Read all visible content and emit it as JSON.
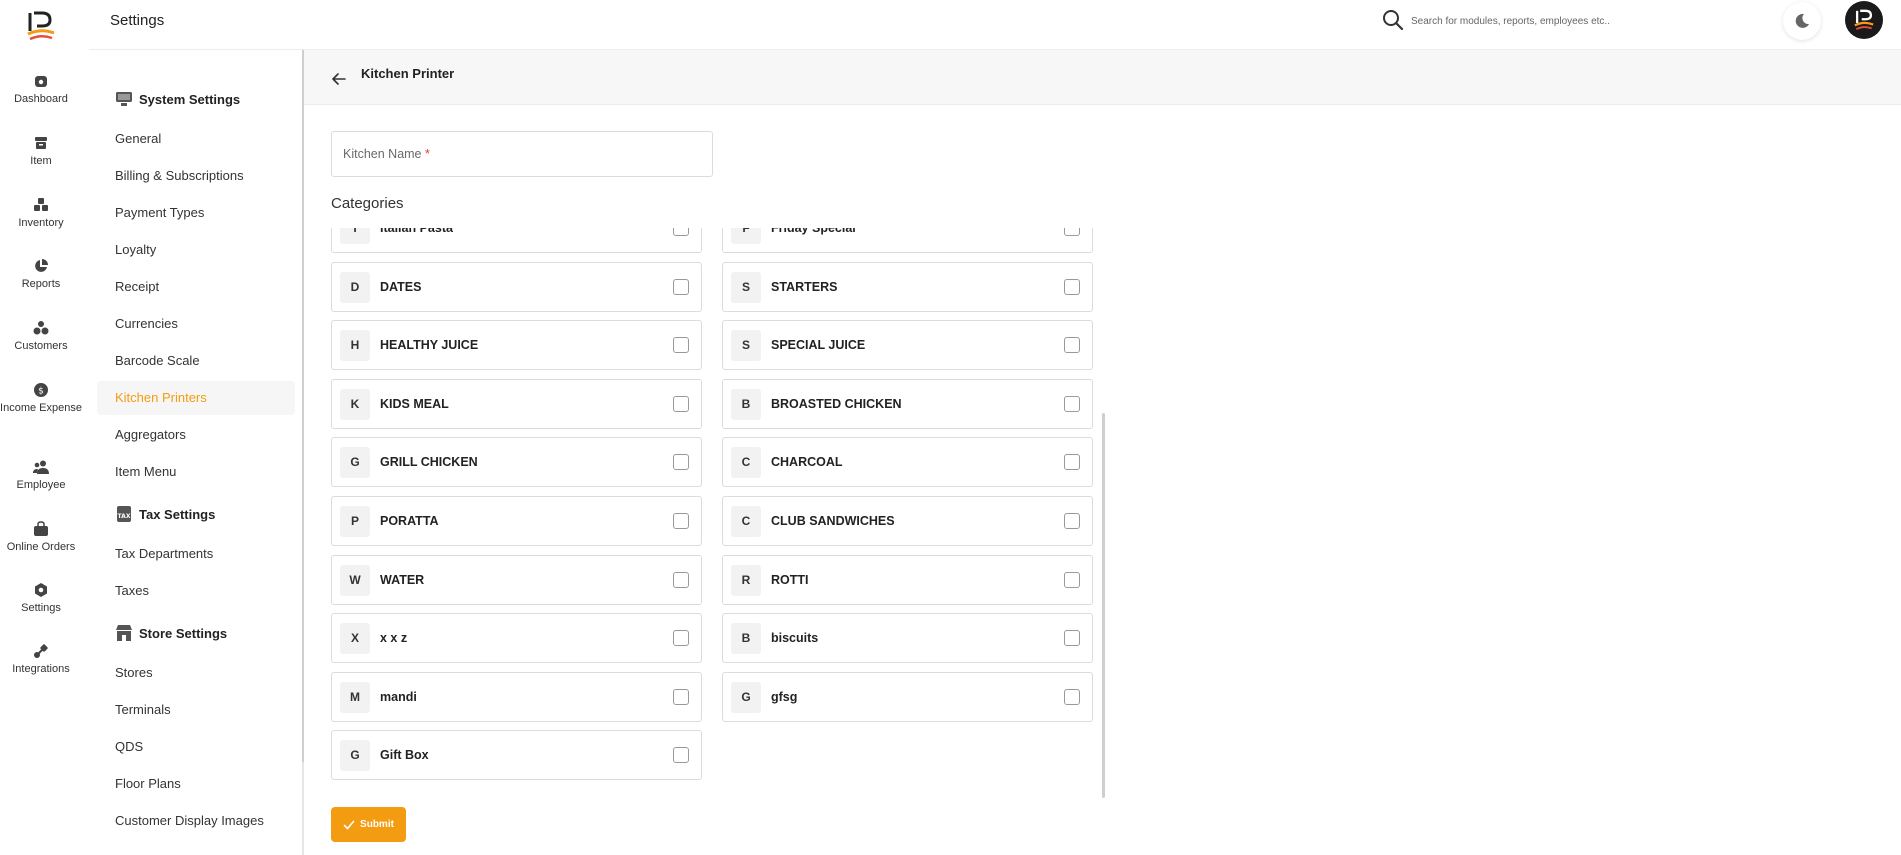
{
  "brand": {
    "accent_color": "#f39c12"
  },
  "rail": {
    "items": [
      {
        "label": "Dashboard",
        "icon": "dashboard-icon"
      },
      {
        "label": "Item",
        "icon": "item-icon"
      },
      {
        "label": "Inventory",
        "icon": "inventory-icon"
      },
      {
        "label": "Reports",
        "icon": "reports-icon"
      },
      {
        "label": "Customers",
        "icon": "customers-icon"
      },
      {
        "label": "Income Expense",
        "icon": "income-expense-icon"
      },
      {
        "label": "Employee",
        "icon": "employee-icon"
      },
      {
        "label": "Online Orders",
        "icon": "online-orders-icon"
      },
      {
        "label": "Settings",
        "icon": "settings-icon"
      },
      {
        "label": "Integrations",
        "icon": "integrations-icon"
      }
    ]
  },
  "header": {
    "title": "Settings",
    "search_placeholder": "Search for modules, reports, employees etc.."
  },
  "settings_nav": {
    "system_settings": {
      "title": "System Settings",
      "items": [
        "General",
        "Billing & Subscriptions",
        "Payment Types",
        "Loyalty",
        "Receipt",
        "Currencies",
        "Barcode Scale",
        "Kitchen Printers",
        "Aggregators",
        "Item Menu"
      ]
    },
    "tax_settings": {
      "title": "Tax Settings",
      "items": [
        "Tax Departments",
        "Taxes"
      ]
    },
    "store_settings": {
      "title": "Store Settings",
      "items": [
        "Stores",
        "Terminals",
        "QDS",
        "Floor Plans",
        "Customer Display Images"
      ]
    },
    "active_item": "Kitchen Printers"
  },
  "main": {
    "subtitle": "Kitchen Printer",
    "kitchen_name_label": "Kitchen Name",
    "required_mark": "*",
    "categories_title": "Categories",
    "categories": [
      {
        "letter": "I",
        "name": "Italian Pasta",
        "checked": false
      },
      {
        "letter": "F",
        "name": "Friday Special",
        "checked": false
      },
      {
        "letter": "D",
        "name": "DATES",
        "checked": false
      },
      {
        "letter": "S",
        "name": "STARTERS",
        "checked": false
      },
      {
        "letter": "H",
        "name": "HEALTHY JUICE",
        "checked": false
      },
      {
        "letter": "S",
        "name": "SPECIAL JUICE",
        "checked": false
      },
      {
        "letter": "K",
        "name": "KIDS MEAL",
        "checked": false
      },
      {
        "letter": "B",
        "name": "BROASTED CHICKEN",
        "checked": false
      },
      {
        "letter": "G",
        "name": "GRILL CHICKEN",
        "checked": false
      },
      {
        "letter": "C",
        "name": "CHARCOAL",
        "checked": false
      },
      {
        "letter": "P",
        "name": "PORATTA",
        "checked": false
      },
      {
        "letter": "C",
        "name": "CLUB SANDWICHES",
        "checked": false
      },
      {
        "letter": "W",
        "name": "WATER",
        "checked": false
      },
      {
        "letter": "R",
        "name": "ROTTI",
        "checked": false
      },
      {
        "letter": "X",
        "name": "x x z",
        "checked": false
      },
      {
        "letter": "B",
        "name": "biscuits",
        "checked": false
      },
      {
        "letter": "M",
        "name": "mandi",
        "checked": false
      },
      {
        "letter": "G",
        "name": "gfsg",
        "checked": false
      },
      {
        "letter": "G",
        "name": "Gift Box",
        "checked": false
      }
    ],
    "submit_label": "Submit"
  }
}
